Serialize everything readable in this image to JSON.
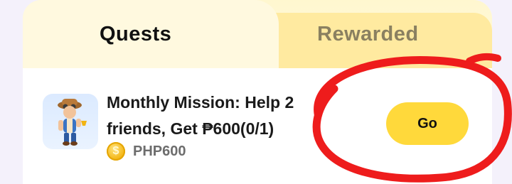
{
  "tabs": [
    {
      "label": "Quests",
      "active": true
    },
    {
      "label": "Rewarded",
      "active": false
    }
  ],
  "quest": {
    "title": "Monthly Mission: Help 2 friends, Get ₱600(0/1)",
    "reward_icon": "coin-icon",
    "reward_amount": "PHP600",
    "go_label": "Go",
    "thumbnail_icon": "explorer-character-icon"
  },
  "colors": {
    "accent_button": "#ffd93b",
    "active_tab": "#fff9df",
    "inactive_tab": "#ffeaa0",
    "annotation_stroke": "#ee1c1c"
  }
}
